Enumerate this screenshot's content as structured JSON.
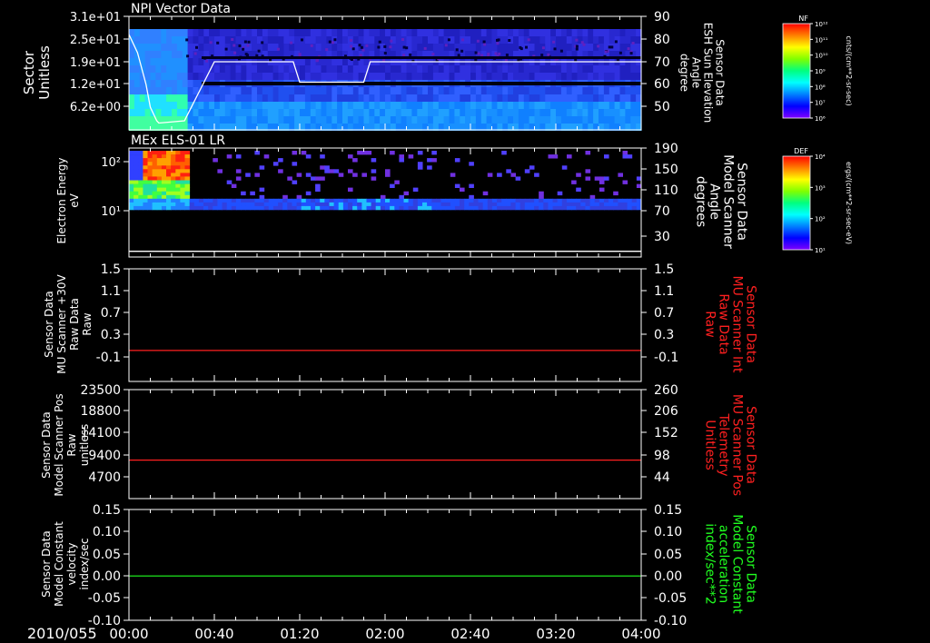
{
  "date_label": "2010/055",
  "time_ticks": [
    "00:00",
    "00:40",
    "01:20",
    "02:00",
    "02:40",
    "03:20",
    "04:00"
  ],
  "colors": {
    "background": "#000000",
    "axes": "#ffffff",
    "red": "#ff2020",
    "green": "#20ff20"
  },
  "chart_data": [
    {
      "type": "heatmap",
      "title": "NPI Vector Data",
      "ylabel_lines": [
        "Sector",
        "Unitless"
      ],
      "yticks": [
        "3.1e+01",
        "2.5e+01",
        "1.9e+01",
        "1.2e+01",
        "6.2e+00"
      ],
      "right_ylabel_lines": [
        "Sensor Data",
        "ESH Sun Elevation",
        "Angle",
        "degree"
      ],
      "right_yticks": [
        "90",
        "80",
        "70",
        "60",
        "50"
      ],
      "right_ylim": [
        40,
        90
      ],
      "colorbar": {
        "label": "NF",
        "unit": "cnts/(cm**2-sr-sec)",
        "ticks": [
          "10¹²",
          "10¹¹",
          "10¹⁰",
          "10⁹",
          "10⁸",
          "10⁷",
          "10⁶"
        ]
      },
      "overlay_line": {
        "x_min": [
          0,
          4,
          8,
          10,
          13,
          14,
          26,
          40,
          77,
          80,
          95,
          110,
          113,
          240
        ],
        "y_deg": [
          82,
          74,
          60,
          50,
          44,
          43,
          44,
          70,
          70,
          61,
          61,
          61,
          70,
          70
        ]
      }
    },
    {
      "type": "heatmap",
      "title": "MEx ELS-01 LR",
      "ylabel_lines": [
        "Electron Energy",
        "eV"
      ],
      "yticks": [
        "10²",
        "10¹"
      ],
      "right_ylabel_lines": [
        "Sensor Data",
        "Model Scanner",
        "Angle",
        "degrees"
      ],
      "right_yticks": [
        "190",
        "150",
        "110",
        "70",
        "30"
      ],
      "right_ylim": [
        0,
        190
      ],
      "colorbar": {
        "label": "DEF",
        "unit": "ergs/(cm**2-sr-sec-eV)",
        "ticks": [
          "10⁴",
          "10³",
          "10²",
          "10¹"
        ]
      },
      "overlay_line": {
        "x_min": [
          0,
          240
        ],
        "y_deg": [
          10,
          10
        ]
      }
    },
    {
      "type": "line",
      "ylabel_lines": [
        "Sensor Data",
        "MU Scanner +30V",
        "Raw Data",
        "Raw"
      ],
      "yticks": [
        "1.5",
        "1.1",
        "0.7",
        "0.3",
        "-0.1"
      ],
      "ylim": [
        -0.5,
        1.5
      ],
      "right_ylabel_lines": [
        "Sensor Data",
        "MU Scanner Int",
        "Raw Data",
        "Raw"
      ],
      "right_yticks": [
        "1.5",
        "1.1",
        "0.7",
        "0.3",
        "-0.1"
      ],
      "series": [
        {
          "color": "#ff2020",
          "x_min": [
            0,
            240
          ],
          "y": [
            0.05,
            0.05
          ]
        }
      ]
    },
    {
      "type": "line",
      "ylabel_lines": [
        "Sensor Data",
        "Model Scanner Pos",
        "Raw",
        "unitless"
      ],
      "yticks": [
        "23500",
        "18800",
        "14100",
        "9400",
        "4700"
      ],
      "ylim": [
        0,
        23500
      ],
      "right_ylabel_lines": [
        "Sensor Data",
        "MU Scanner Pos",
        "Telemetry",
        "Unitless"
      ],
      "right_yticks": [
        "260",
        "206",
        "152",
        "98",
        "44"
      ],
      "series": [
        {
          "color": "#ff2020",
          "x_min": [
            0,
            240
          ],
          "y": [
            8300,
            8300
          ]
        }
      ]
    },
    {
      "type": "line",
      "ylabel_lines": [
        "Sensor Data",
        "Model Constant",
        "velocity",
        "index/sec"
      ],
      "yticks": [
        "0.15",
        "0.10",
        "0.05",
        "0.00",
        "-0.05",
        "-0.10"
      ],
      "ylim": [
        -0.1,
        0.15
      ],
      "right_ylabel_lines": [
        "Sensor Data",
        "Model Constant",
        "acceleration",
        "index/sec**2"
      ],
      "right_yticks": [
        "0.15",
        "0.10",
        "0.05",
        "0.00",
        "-0.05",
        "-0.10"
      ],
      "series": [
        {
          "color": "#20ff20",
          "x_min": [
            0,
            240
          ],
          "y": [
            0.0,
            0.0
          ]
        }
      ]
    }
  ]
}
